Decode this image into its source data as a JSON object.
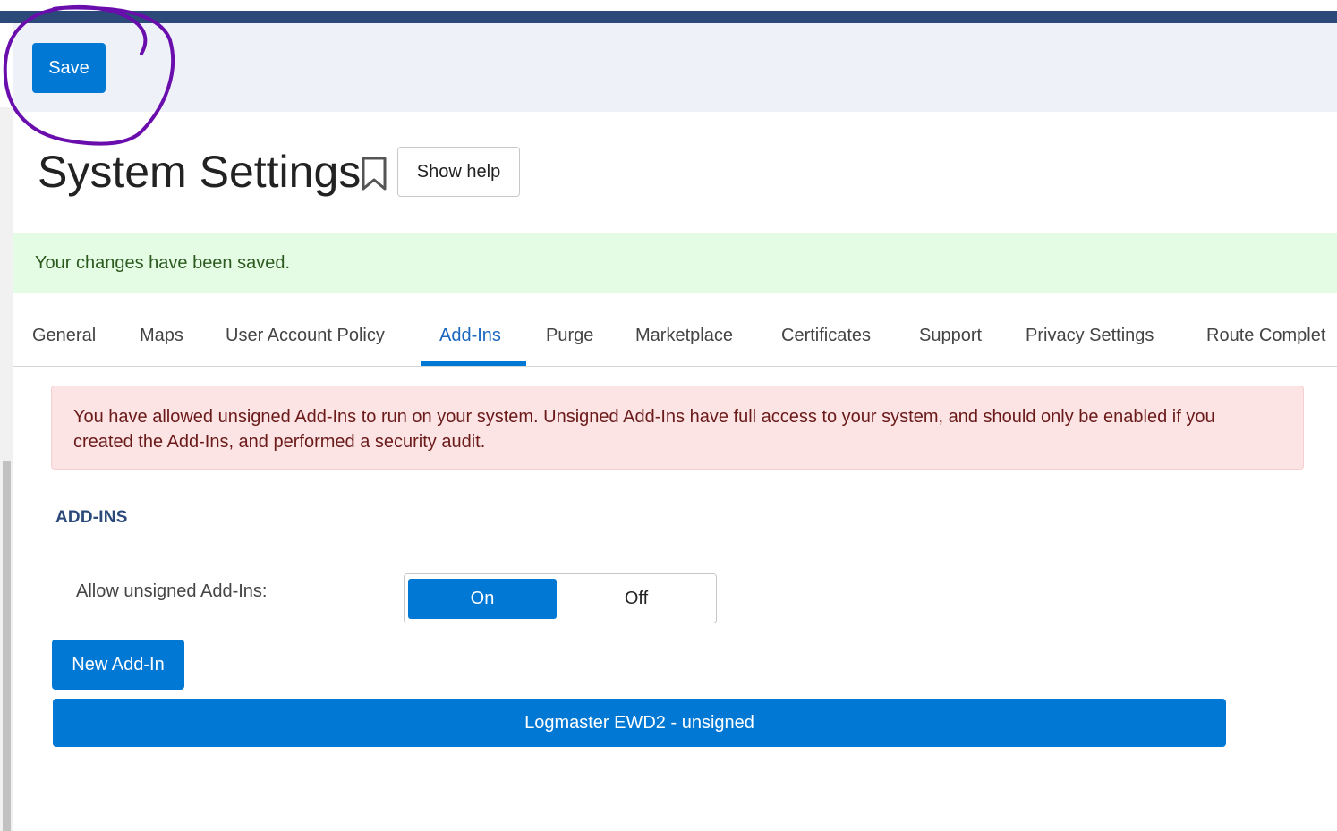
{
  "toolbar": {
    "save_label": "Save"
  },
  "page": {
    "title": "System Settings",
    "show_help_label": "Show help"
  },
  "success_banner": {
    "text": "Your changes have been saved."
  },
  "tabs": [
    {
      "label": "General"
    },
    {
      "label": "Maps"
    },
    {
      "label": "User Account Policy"
    },
    {
      "label": "Add-Ins",
      "active": true
    },
    {
      "label": "Purge"
    },
    {
      "label": "Marketplace"
    },
    {
      "label": "Certificates"
    },
    {
      "label": "Support"
    },
    {
      "label": "Privacy Settings"
    },
    {
      "label": "Route Complet"
    }
  ],
  "warning": {
    "text": "You have allowed unsigned Add-Ins to run on your system. Unsigned Add-Ins have full access to your system, and should only be enabled if you created the Add-Ins, and performed a security audit."
  },
  "addins": {
    "heading": "ADD-INS",
    "allow_unsigned_label": "Allow unsigned Add-Ins:",
    "toggle": {
      "on_label": "On",
      "off_label": "Off",
      "selected": "On"
    },
    "new_button_label": "New Add-In",
    "items": [
      {
        "label": "Logmaster EWD2 - unsigned"
      }
    ]
  },
  "colors": {
    "accent": "#0078d4",
    "header_bar": "#2b4a7a",
    "success_bg": "#e4fbe4",
    "warning_bg": "#fce4e4",
    "annotation": "#6a0dad"
  },
  "icons": {
    "bookmark": "bookmark-icon"
  }
}
